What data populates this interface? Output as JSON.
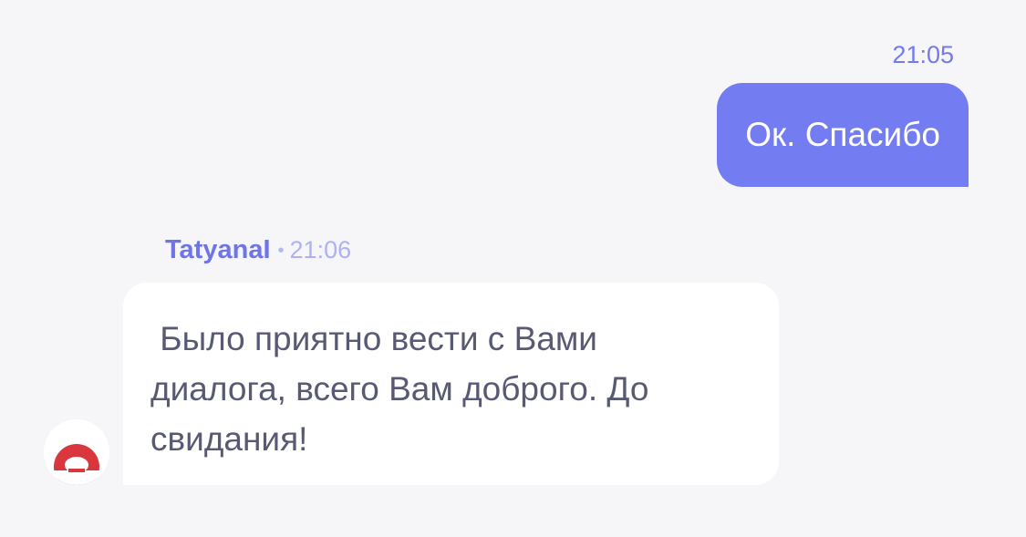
{
  "messages": {
    "outgoing": {
      "time": "21:05",
      "text": "Ок. Спасибо"
    },
    "incoming": {
      "author": "TatyanaI",
      "separator": "•",
      "time": "21:06",
      "text": " Было приятно вести с Вами\nдиалога, всего Вам доброго. До\nсвидания!",
      "avatar_icon": "operator-logo-icon"
    }
  },
  "colors": {
    "background": "#f6f6f9",
    "outgoing_bubble": "#737cf1",
    "accent": "#6f74e6",
    "incoming_text": "#585a73",
    "avatar_logo": "#d9363e"
  }
}
